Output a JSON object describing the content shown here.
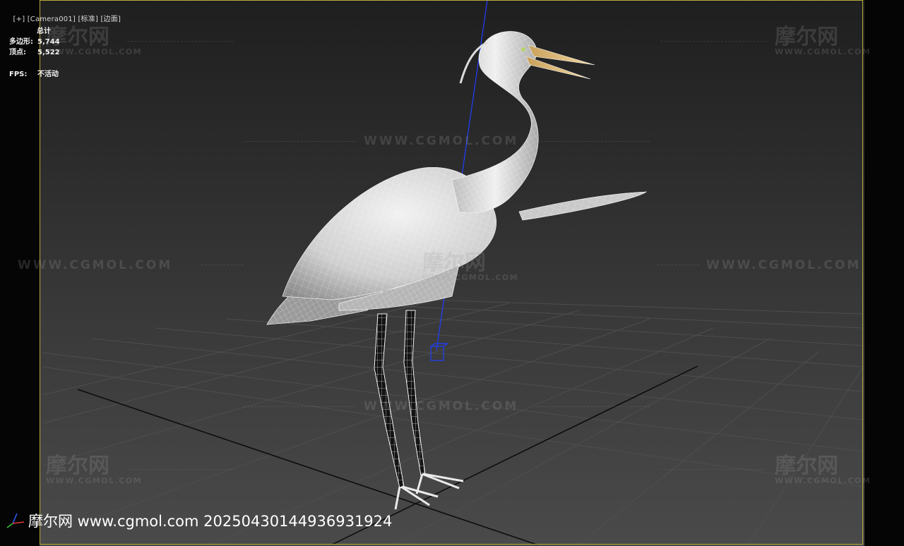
{
  "viewport": {
    "menu_plus": "[+]",
    "camera": "[Camera001]",
    "shading": "[标准]",
    "edges": "[边面]"
  },
  "stats": {
    "header": "总计",
    "polygons_label": "多边形:",
    "polygons_value": "5,744",
    "vertices_label": "顶点:",
    "vertices_value": "5,522",
    "fps_label": "FPS:",
    "fps_value": "不活动"
  },
  "watermarks": {
    "site": "WWW.CGMOL.COM",
    "logo": "摩尔网",
    "logo_sub": "WWW.CGMOL.COM"
  },
  "footer": {
    "text": "摩尔网 www.cgmol.com 20250430144936931924"
  },
  "colors": {
    "frame": "#b8a93a",
    "gizmo_axis": "#1f3fff",
    "mesh": "#e8e8e8"
  }
}
